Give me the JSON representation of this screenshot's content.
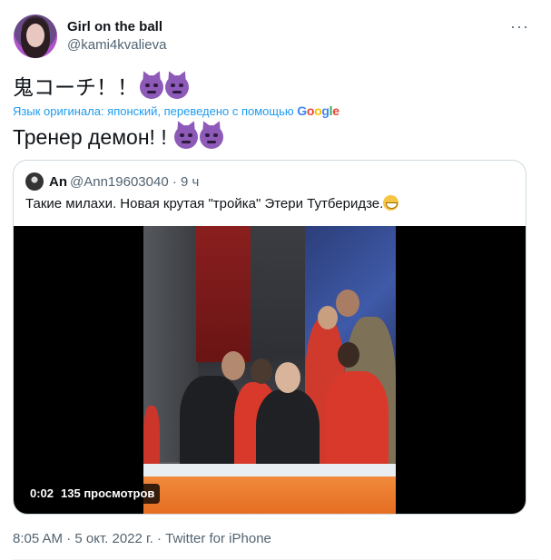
{
  "author": {
    "name": "Girl on the ball",
    "handle": "@kami4kvalieva"
  },
  "tweet": {
    "original_text": "鬼コーチ！！",
    "original_emojis": [
      "smiling-imp-emoji",
      "smiling-imp-emoji"
    ],
    "translation_notice": "Язык оригинала: японский, переведено с помощью",
    "translation_provider": [
      "G",
      "o",
      "o",
      "g",
      "l",
      "e"
    ],
    "translated_text": "Тренер демон! !",
    "translated_emojis": [
      "smiling-imp-emoji",
      "smiling-imp-emoji"
    ]
  },
  "quoted": {
    "name": "An",
    "handle_time": "@Ann19603040 · 9 ч",
    "text": "Такие милахи. Новая крутая \"тройка\" Этери Тутберидзе.",
    "text_emoji": "grinning-face-emoji",
    "video": {
      "elapsed": "0:02",
      "views": "135 просмотров"
    }
  },
  "meta": {
    "timestamp_source": "8:05 AM · 5 окт. 2022 г. · Twitter for iPhone"
  },
  "icons": {
    "more": "more-horizontal-icon"
  },
  "colors": {
    "link": "#1d9bf0",
    "secondary_text": "#536471",
    "primary_text": "#0f1419",
    "border": "#cfd9de"
  }
}
